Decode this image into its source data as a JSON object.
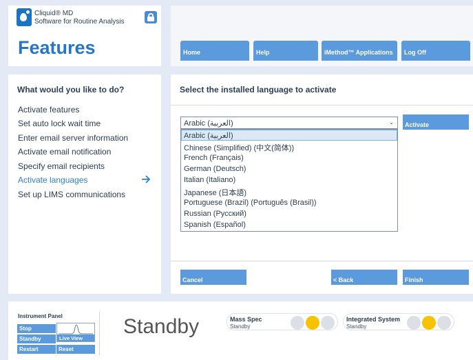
{
  "brand": {
    "app_name_line1": "Cliquid® MD",
    "app_name_line2": "Software for Routine Analysis",
    "page_title": "Features"
  },
  "topnav": {
    "items": [
      {
        "label": "Home"
      },
      {
        "label": "Help"
      },
      {
        "label": "iMethod™ Applications"
      },
      {
        "label": "Log Off"
      }
    ]
  },
  "sidebar": {
    "question": "What would you like to do?",
    "items": [
      {
        "label": "Activate features"
      },
      {
        "label": "Set auto lock wait time"
      },
      {
        "label": "Enter email server information"
      },
      {
        "label": "Activate email notification"
      },
      {
        "label": "Specify email recipients"
      },
      {
        "label": "Activate languages"
      },
      {
        "label": "Set up LIMS communications"
      }
    ],
    "active_index": 5
  },
  "content": {
    "heading": "Select the installed language to activate",
    "language_select": {
      "value": "Arabic (العربية)",
      "options": [
        "Arabic (العربية)",
        "Chinese (Simplified) (中文(简体))",
        "French (Français)",
        "German (Deutsch)",
        "Italian (Italiano)",
        "Japanese (日本語)",
        "Portuguese (Brazil) (Português (Brasil))",
        "Russian (Русский)",
        "Spanish (Español)"
      ]
    },
    "activate_label": "Activate",
    "cancel_label": "Cancel",
    "back_label": "< Back",
    "finish_label": "Finish"
  },
  "instrument_panel": {
    "title": "Instrument Panel",
    "buttons": {
      "stop": "Stop",
      "standby": "Standby",
      "restart": "Restart",
      "live_view": "Live View",
      "reset": "Reset"
    },
    "status": "Standby",
    "mass_spec": {
      "name": "Mass Spec",
      "state": "Standby"
    },
    "integrated_system": {
      "name": "Integrated System",
      "state": "Standby"
    }
  },
  "colors": {
    "accent": "#2676c4",
    "button": "#5b9bdd",
    "status_on": "#f7c200",
    "status_off": "#dcdfe6"
  }
}
